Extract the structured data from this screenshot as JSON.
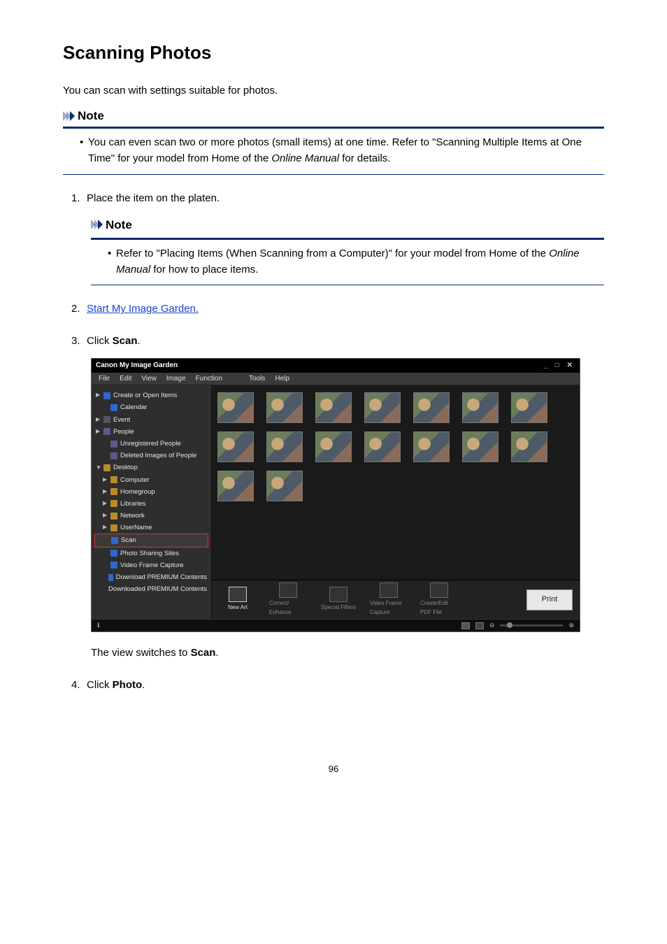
{
  "page": {
    "title": "Scanning Photos",
    "intro": "You can scan with settings suitable for photos.",
    "number": "96"
  },
  "note_label": "Note",
  "top_note": {
    "line1": "You can even scan two or more photos (small items) at one time. Refer to \"Scanning Multiple Items at One Time\" for your model from Home of the ",
    "em": "Online Manual",
    "line2": " for details."
  },
  "steps": {
    "s1": {
      "num": "1.",
      "text": "Place the item on the platen."
    },
    "s1_note": {
      "line1": "Refer to \"Placing Items (When Scanning from a Computer)\" for your model from Home of the ",
      "em": "Online Manual",
      "line2": " for how to place items."
    },
    "s2": {
      "num": "2.",
      "link": "Start My Image Garden."
    },
    "s3": {
      "num": "3.",
      "pre": "Click ",
      "bold": "Scan",
      "post": ".",
      "after_pre": "The view switches to ",
      "after_bold": "Scan",
      "after_post": "."
    },
    "s4": {
      "num": "4.",
      "pre": "Click ",
      "bold": "Photo",
      "post": "."
    }
  },
  "app": {
    "title": "Canon My Image Garden",
    "win_ctrl": "_ □ ✕",
    "menu": [
      "File",
      "Edit",
      "View",
      "Image",
      "Function",
      "Tools",
      "Help"
    ],
    "side": [
      {
        "label": "Create or Open Items",
        "caret": "▶",
        "cls": "",
        "icon": "blue"
      },
      {
        "label": "Calendar",
        "caret": "",
        "cls": "side-ind1",
        "icon": "blue"
      },
      {
        "label": "Event",
        "caret": "▶",
        "cls": "",
        "icon": "event"
      },
      {
        "label": "People",
        "caret": "▶",
        "cls": "",
        "icon": "people"
      },
      {
        "label": "Unregistered People",
        "caret": "",
        "cls": "side-ind1",
        "icon": "people"
      },
      {
        "label": "Deleted Images of People",
        "caret": "",
        "cls": "side-ind1",
        "icon": "people"
      },
      {
        "label": "Desktop",
        "caret": "▼",
        "cls": "",
        "icon": "folder"
      },
      {
        "label": "Computer",
        "caret": "▶",
        "cls": "side-ind1",
        "icon": "folder"
      },
      {
        "label": "Homegroup",
        "caret": "▶",
        "cls": "side-ind1",
        "icon": "folder"
      },
      {
        "label": "Libraries",
        "caret": "▶",
        "cls": "side-ind1",
        "icon": "folder"
      },
      {
        "label": "Network",
        "caret": "▶",
        "cls": "side-ind1",
        "icon": "folder"
      },
      {
        "label": "UserName",
        "caret": "▶",
        "cls": "side-ind1",
        "icon": "folder"
      },
      {
        "label": "Scan",
        "caret": "",
        "cls": "side-ind1 sel",
        "icon": "blue"
      },
      {
        "label": "Photo Sharing Sites",
        "caret": "",
        "cls": "side-ind1",
        "icon": "blue"
      },
      {
        "label": "Video Frame Capture",
        "caret": "",
        "cls": "side-ind1",
        "icon": "blue"
      },
      {
        "label": "Download PREMIUM Contents",
        "caret": "",
        "cls": "side-ind1",
        "icon": "blue"
      },
      {
        "label": "Downloaded PREMIUM Contents",
        "caret": "",
        "cls": "side-ind1",
        "icon": "folder"
      }
    ],
    "bottom": [
      {
        "label": "New Art",
        "active": true
      },
      {
        "label": "Correct/ Enhance",
        "active": false
      },
      {
        "label": "Special Filters",
        "active": false
      },
      {
        "label": "Video Frame Capture",
        "active": false
      },
      {
        "label": "Create/Edit PDF File",
        "active": false
      }
    ],
    "print_label": "Print",
    "status_zoom": "⊖",
    "status_plus": "⊕",
    "status_info": "ℹ"
  }
}
